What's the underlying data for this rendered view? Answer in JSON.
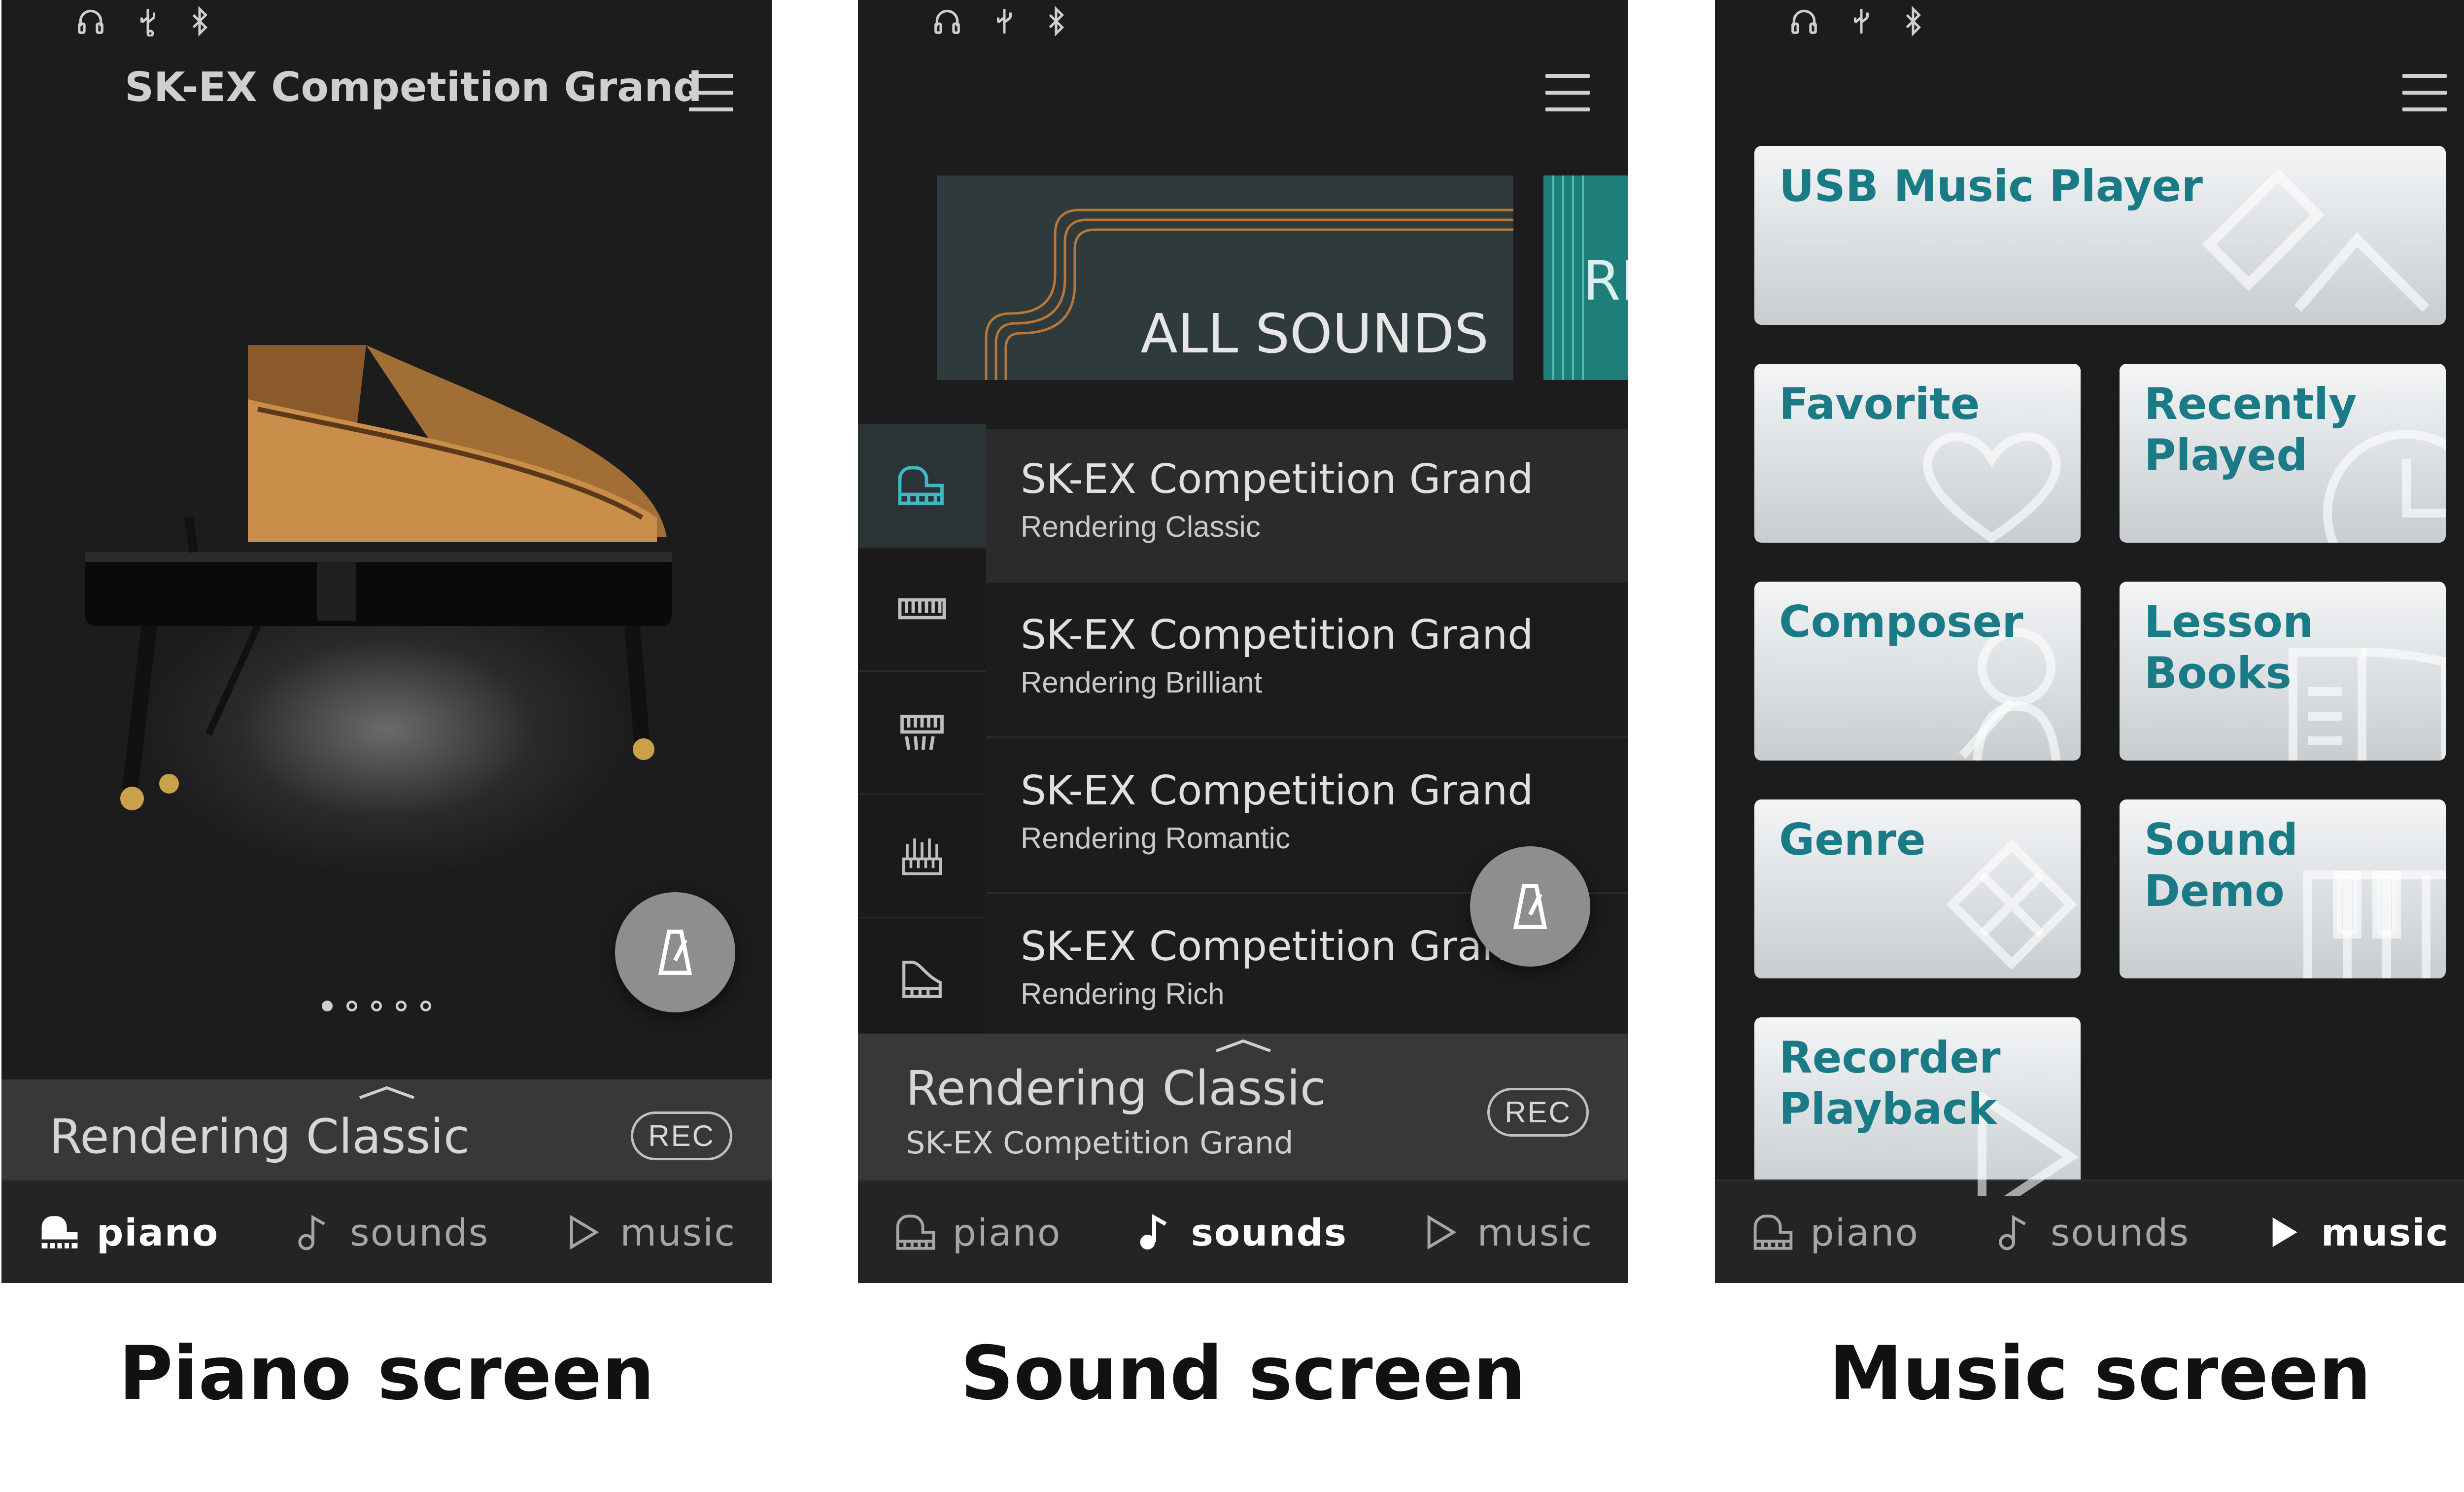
{
  "captions": [
    "Piano screen",
    "Sound screen",
    "Music screen"
  ],
  "status_icons": [
    "headphones-icon",
    "usb-icon",
    "bluetooth-icon"
  ],
  "nav": {
    "piano": "piano",
    "sounds": "sounds",
    "music": "music"
  },
  "piano_screen": {
    "title": "SK-EX Competition Grand",
    "page_dots": {
      "count": 5,
      "active": 1
    },
    "current_rendering": "Rendering Classic",
    "rec_label": "REC",
    "active_tab": "piano"
  },
  "sound_screen": {
    "banners": [
      "ALL SOUNDS",
      "RI"
    ],
    "category_icons": [
      "grand-piano-icon",
      "electric-piano-icon",
      "harpsichord-icon",
      "organ-icon",
      "upright-piano-icon"
    ],
    "sounds": [
      {
        "name": "SK-EX Competition Grand",
        "rendering": "Rendering Classic"
      },
      {
        "name": "SK-EX Competition Grand",
        "rendering": "Rendering Brilliant"
      },
      {
        "name": "SK-EX Competition Grand",
        "rendering": "Rendering Romantic"
      },
      {
        "name": "SK-EX Competition Grand",
        "rendering": "Rendering Rich"
      }
    ],
    "current_rendering": "Rendering Classic",
    "current_sound": "SK-EX Competition Grand",
    "rec_label": "REC",
    "active_tab": "sounds"
  },
  "music_screen": {
    "tiles": [
      {
        "label": "USB Music Player",
        "icon": "usb-stick-icon"
      },
      {
        "label": "Favorite",
        "icon": "heart-icon"
      },
      {
        "label": "Recently\nPlayed",
        "icon": "clock-icon"
      },
      {
        "label": "Composer",
        "icon": "bust-icon"
      },
      {
        "label": "Lesson\nBooks",
        "icon": "book-icon"
      },
      {
        "label": "Genre",
        "icon": "genre-icon"
      },
      {
        "label": "Sound Demo",
        "icon": "keyboard-icon"
      },
      {
        "label": "Recorder\nPlayback",
        "icon": "play-icon"
      }
    ],
    "active_tab": "music"
  },
  "colors": {
    "tile_label": "#1a7a86",
    "teal_banner": "#1e7f7a",
    "background": "#1c1c1c"
  }
}
